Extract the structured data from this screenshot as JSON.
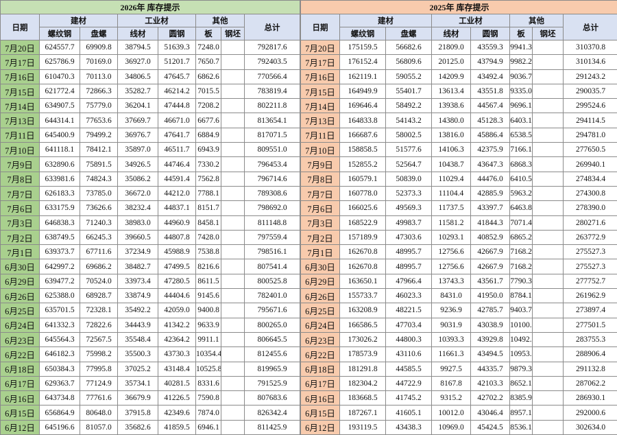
{
  "left": {
    "title": "2026年  库存提示",
    "headers": {
      "date": "日期",
      "jiancai": "建材",
      "gongye": "工业材",
      "qita": "其他",
      "total": "总计",
      "sub": [
        "螺纹钢",
        "盘螺",
        "线材",
        "圆钢",
        "板",
        "钢坯"
      ]
    },
    "rows": [
      [
        "7月20日",
        "624557.7",
        "69909.8",
        "38794.5",
        "51639.3",
        "7248.0",
        "",
        "792817.6"
      ],
      [
        "7月17日",
        "625786.9",
        "70169.0",
        "36927.0",
        "51201.7",
        "7650.7",
        "",
        "792403.5"
      ],
      [
        "7月16日",
        "610470.3",
        "70113.0",
        "34806.5",
        "47645.7",
        "6862.6",
        "",
        "770566.4"
      ],
      [
        "7月15日",
        "621772.4",
        "72866.3",
        "35282.7",
        "46214.2",
        "7015.5",
        "",
        "783819.4"
      ],
      [
        "7月14日",
        "634907.5",
        "75779.0",
        "36204.1",
        "47444.8",
        "7208.2",
        "",
        "802211.8"
      ],
      [
        "7月13日",
        "644314.1",
        "77653.6",
        "37669.7",
        "46671.0",
        "6677.6",
        "",
        "813654.1"
      ],
      [
        "7月11日",
        "645400.9",
        "79499.2",
        "36976.7",
        "47641.7",
        "6884.9",
        "",
        "817071.5"
      ],
      [
        "7月10日",
        "641118.1",
        "78412.1",
        "35897.0",
        "46511.7",
        "6943.9",
        "",
        "809551.0"
      ],
      [
        "7月9日",
        "632890.6",
        "75891.5",
        "34926.5",
        "44746.4",
        "7330.2",
        "",
        "796453.4"
      ],
      [
        "7月8日",
        "633981.6",
        "74824.3",
        "35086.2",
        "44591.4",
        "7562.8",
        "",
        "796714.6"
      ],
      [
        "7月7日",
        "626183.3",
        "73785.0",
        "36672.0",
        "44212.0",
        "7788.1",
        "",
        "789308.6"
      ],
      [
        "7月6日",
        "633175.9",
        "73626.6",
        "38232.4",
        "44837.1",
        "8151.7",
        "",
        "798692.0"
      ],
      [
        "7月3日",
        "646838.3",
        "71240.3",
        "38983.0",
        "44960.9",
        "8458.1",
        "",
        "811148.8"
      ],
      [
        "7月2日",
        "638749.5",
        "66245.3",
        "39660.5",
        "44807.8",
        "7428.0",
        "",
        "797559.4"
      ],
      [
        "7月1日",
        "639373.7",
        "67711.6",
        "37234.9",
        "45988.9",
        "7538.8",
        "",
        "798516.1"
      ],
      [
        "6月30日",
        "642997.2",
        "69686.2",
        "38482.7",
        "47499.5",
        "8216.6",
        "",
        "807541.4"
      ],
      [
        "6月29日",
        "639477.2",
        "70524.0",
        "33973.4",
        "47280.5",
        "8611.5",
        "",
        "800525.8"
      ],
      [
        "6月26日",
        "625388.0",
        "68928.7",
        "33874.9",
        "44404.6",
        "9145.6",
        "",
        "782401.0"
      ],
      [
        "6月25日",
        "635701.5",
        "72328.1",
        "35492.2",
        "42059.0",
        "9400.8",
        "",
        "795671.6"
      ],
      [
        "6月24日",
        "641332.3",
        "72822.6",
        "34443.9",
        "41342.2",
        "9633.9",
        "",
        "800265.0"
      ],
      [
        "6月23日",
        "645564.3",
        "72567.5",
        "35548.4",
        "42364.2",
        "9911.1",
        "",
        "806645.5"
      ],
      [
        "6月22日",
        "646182.3",
        "75998.2",
        "35500.3",
        "43730.3",
        "10354.4",
        "",
        "812455.6"
      ],
      [
        "6月18日",
        "650384.3",
        "77995.8",
        "37025.2",
        "43148.4",
        "10525.8",
        "",
        "819965.9"
      ],
      [
        "6月17日",
        "629363.7",
        "77124.9",
        "35734.1",
        "40281.5",
        "8331.6",
        "",
        "791525.9"
      ],
      [
        "6月16日",
        "643734.8",
        "77761.6",
        "36679.9",
        "41226.5",
        "7590.8",
        "",
        "807683.6"
      ],
      [
        "6月15日",
        "656864.9",
        "80648.0",
        "37915.8",
        "42349.6",
        "7874.0",
        "",
        "826342.4"
      ],
      [
        "6月12日",
        "645196.6",
        "81057.0",
        "35682.6",
        "41859.5",
        "6946.1",
        "",
        "811425.9"
      ]
    ]
  },
  "right": {
    "title": "2025年  库存提示",
    "headers": {
      "date": "日期",
      "jiancai": "建材",
      "gongye": "工业材",
      "qita": "其他",
      "total": "总计",
      "sub": [
        "螺纹钢",
        "盘螺",
        "线材",
        "圆钢",
        "板",
        "钢坯"
      ]
    },
    "rows": [
      [
        "7月20日",
        "175159.5",
        "56682.6",
        "21809.0",
        "43559.3",
        "9941.3",
        "",
        "310370.8"
      ],
      [
        "7月17日",
        "176152.4",
        "56809.6",
        "20125.0",
        "43794.9",
        "9982.2",
        "",
        "310134.6"
      ],
      [
        "7月16日",
        "162119.1",
        "59055.2",
        "14209.9",
        "43492.4",
        "9036.7",
        "",
        "291243.2"
      ],
      [
        "7月15日",
        "164949.9",
        "55401.7",
        "13613.4",
        "43551.8",
        "9335.0",
        "",
        "290035.7"
      ],
      [
        "7月14日",
        "169646.4",
        "58492.2",
        "13938.6",
        "44567.4",
        "9696.1",
        "",
        "299524.6"
      ],
      [
        "7月13日",
        "164833.8",
        "54143.2",
        "14380.0",
        "45128.3",
        "6403.1",
        "",
        "294114.5"
      ],
      [
        "7月11日",
        "166687.6",
        "58002.5",
        "13816.0",
        "45886.4",
        "6538.5",
        "",
        "294781.0"
      ],
      [
        "7月10日",
        "158858.5",
        "51577.6",
        "14106.3",
        "42375.9",
        "7166.1",
        "",
        "277650.5"
      ],
      [
        "7月9日",
        "152855.2",
        "52564.7",
        "10438.7",
        "43647.3",
        "6868.3",
        "",
        "269940.1"
      ],
      [
        "7月8日",
        "160579.1",
        "50839.0",
        "11029.4",
        "44476.0",
        "6410.5",
        "",
        "274834.4"
      ],
      [
        "7月7日",
        "160778.0",
        "52373.3",
        "11104.4",
        "42885.9",
        "5963.2",
        "",
        "274300.8"
      ],
      [
        "7月6日",
        "166025.6",
        "49569.3",
        "11737.5",
        "43397.7",
        "6463.8",
        "",
        "278390.0"
      ],
      [
        "7月3日",
        "168522.9",
        "49983.7",
        "11581.2",
        "41844.3",
        "7071.4",
        "",
        "280271.6"
      ],
      [
        "7月2日",
        "157189.9",
        "47303.6",
        "10293.1",
        "40852.9",
        "6865.2",
        "",
        "263772.9"
      ],
      [
        "7月1日",
        "162670.8",
        "48995.7",
        "12756.6",
        "42667.9",
        "7168.2",
        "",
        "275527.3"
      ],
      [
        "6月30日",
        "162670.8",
        "48995.7",
        "12756.6",
        "42667.9",
        "7168.2",
        "",
        "275527.3"
      ],
      [
        "6月29日",
        "163650.1",
        "47966.4",
        "13743.3",
        "43561.7",
        "7790.3",
        "",
        "277752.7"
      ],
      [
        "6月26日",
        "155733.7",
        "46023.3",
        "8431.0",
        "41950.0",
        "8784.1",
        "",
        "261962.9"
      ],
      [
        "6月25日",
        "163208.9",
        "48221.5",
        "9236.9",
        "42785.7",
        "9403.7",
        "",
        "273897.4"
      ],
      [
        "6月24日",
        "166586.5",
        "47703.4",
        "9031.9",
        "43038.9",
        "10100.0",
        "",
        "277501.5"
      ],
      [
        "6月23日",
        "173026.2",
        "44800.3",
        "10393.3",
        "43929.8",
        "10492.7",
        "",
        "283755.3"
      ],
      [
        "6月22日",
        "178573.9",
        "43110.6",
        "11661.3",
        "43494.5",
        "10953.0",
        "",
        "288906.4"
      ],
      [
        "6月18日",
        "181291.8",
        "44585.5",
        "9927.5",
        "44335.7",
        "9879.3",
        "",
        "291132.8"
      ],
      [
        "6月17日",
        "182304.2",
        "44722.9",
        "8167.8",
        "42103.3",
        "8652.1",
        "",
        "287062.2"
      ],
      [
        "6月16日",
        "183668.5",
        "41745.2",
        "9315.2",
        "42702.2",
        "8385.9",
        "",
        "286930.1"
      ],
      [
        "6月15日",
        "187267.1",
        "41605.1",
        "10012.0",
        "43046.4",
        "8957.1",
        "",
        "292000.6"
      ],
      [
        "6月12日",
        "193119.5",
        "43438.3",
        "10969.0",
        "45424.5",
        "8536.1",
        "",
        "302634.0"
      ]
    ]
  }
}
